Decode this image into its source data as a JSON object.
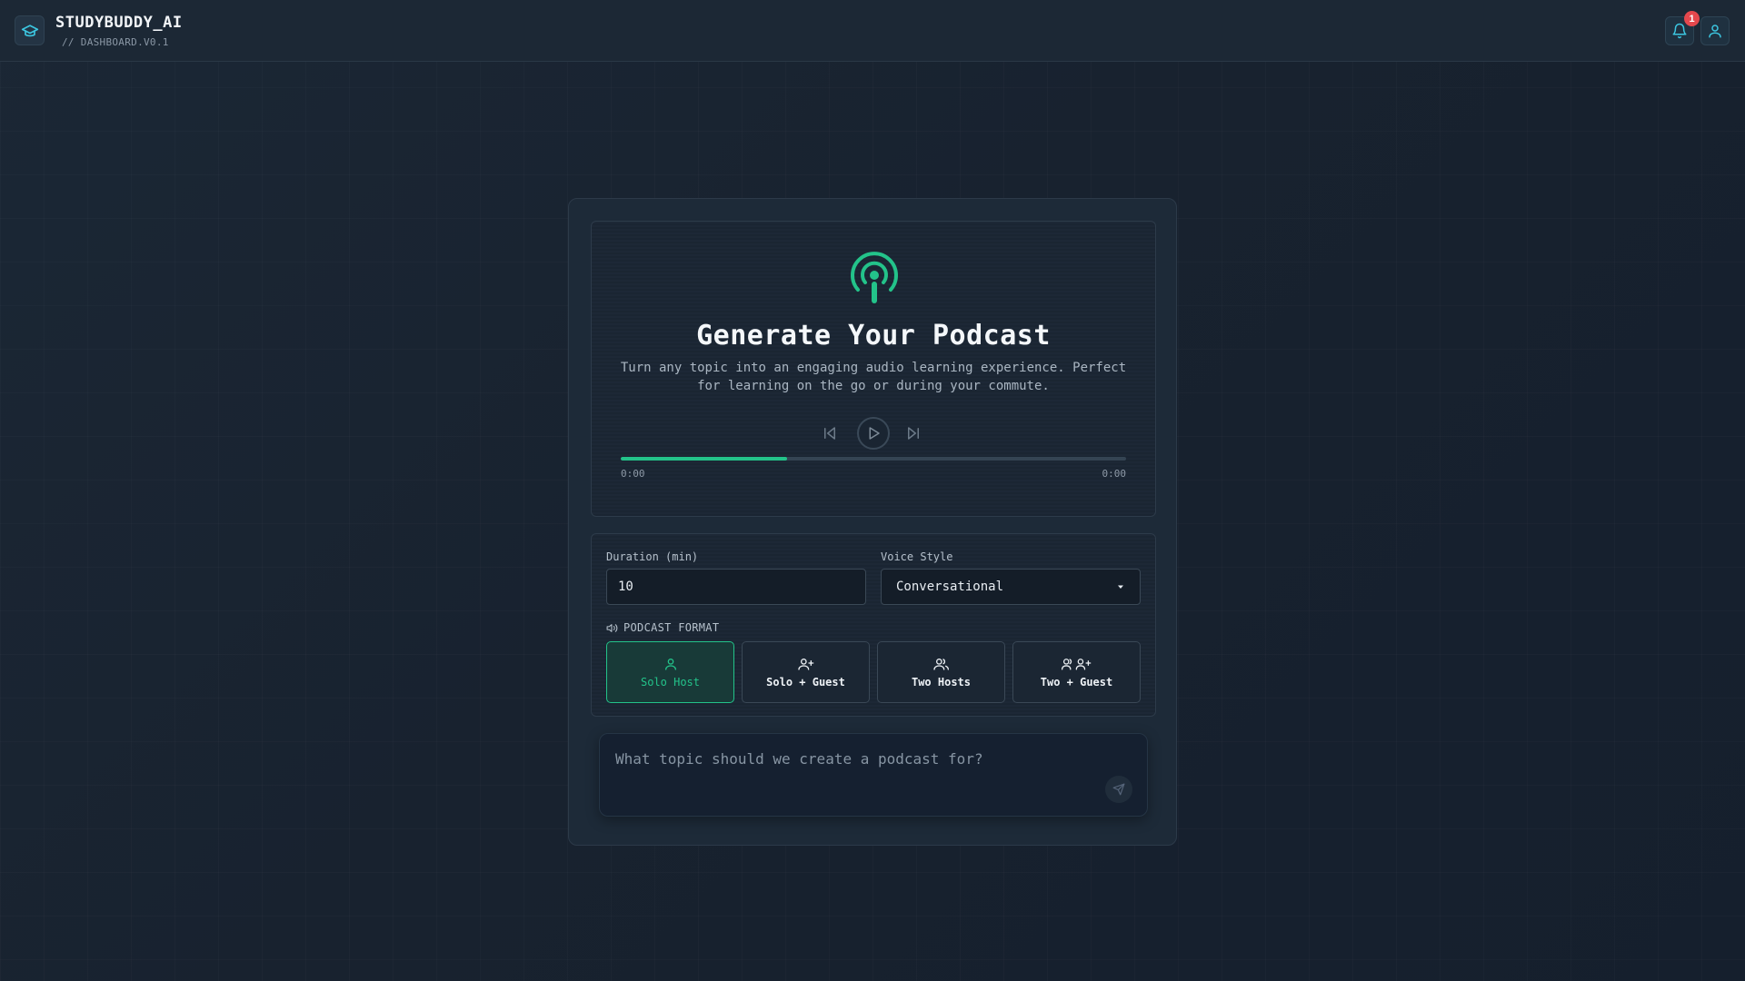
{
  "header": {
    "app_name": "STUDYBUDDY_AI",
    "subtitle": "// DASHBOARD.V0.1",
    "notifications_count": "1"
  },
  "hero": {
    "title": "Generate Your Podcast",
    "description": "Turn any topic into an engaging audio learning experience. Perfect for learning on the go or during your commute.",
    "player": {
      "current_time": "0:00",
      "total_time": "0:00",
      "progress_fraction": 0.33
    }
  },
  "settings": {
    "duration_label": "Duration (min)",
    "duration_value": "10",
    "voice_label": "Voice Style",
    "voice_value": "Conversational",
    "format_label": "PODCAST FORMAT",
    "formats": [
      {
        "label": "Solo Host",
        "icon": "user-icon",
        "selected": true
      },
      {
        "label": "Solo + Guest",
        "icon": "user-plus-icon",
        "selected": false
      },
      {
        "label": "Two Hosts",
        "icon": "users-icon",
        "selected": false
      },
      {
        "label": "Two + Guest",
        "icon": "users-plus-icon",
        "selected": false
      }
    ]
  },
  "prompt": {
    "placeholder": "What topic should we create a podcast for?"
  },
  "colors": {
    "accent": "#23c38a",
    "background": "#18222f",
    "badge": "#e5484d"
  }
}
